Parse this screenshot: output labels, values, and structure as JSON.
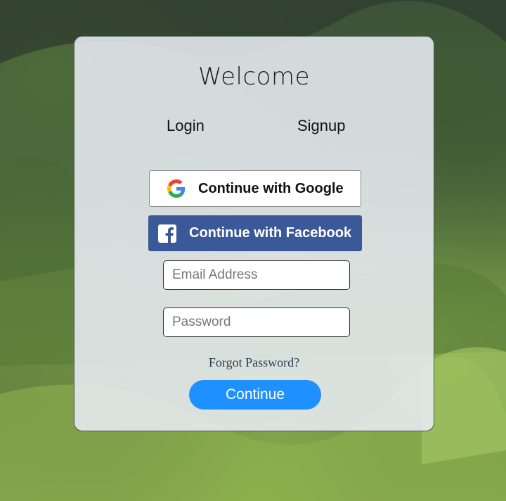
{
  "title": "Welcome",
  "tabs": {
    "login": "Login",
    "signup": "Signup"
  },
  "social": {
    "google_label": "Continue with Google",
    "facebook_label": "Continue with Facebook"
  },
  "form": {
    "email": {
      "placeholder": "Email Address",
      "value": ""
    },
    "password": {
      "placeholder": "Password",
      "value": ""
    },
    "forgot_label": "Forgot Password?",
    "continue_label": "Continue"
  },
  "colors": {
    "facebook": "#3b5998",
    "continue_button": "#1e90ff"
  }
}
